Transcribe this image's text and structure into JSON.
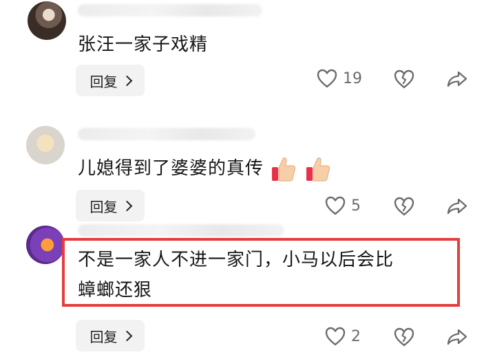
{
  "comments": [
    {
      "text": "张汪一家子戏精",
      "reply_label": "回复",
      "like_count": "19"
    },
    {
      "text": "儿媳得到了婆婆的真传",
      "emojis": [
        "thumbs-up-icon",
        "thumbs-up-icon"
      ],
      "reply_label": "回复",
      "like_count": "5"
    },
    {
      "text_line1": "不是一家人不进一家门，小马以后会比",
      "text_line2": "蟑螂还狠",
      "reply_label": "回复",
      "like_count": "2"
    }
  ],
  "highlight_color": "#e73c3c",
  "icons": {
    "like": "heart-outline-icon",
    "dislike": "broken-heart-icon",
    "share": "share-arrow-icon"
  }
}
